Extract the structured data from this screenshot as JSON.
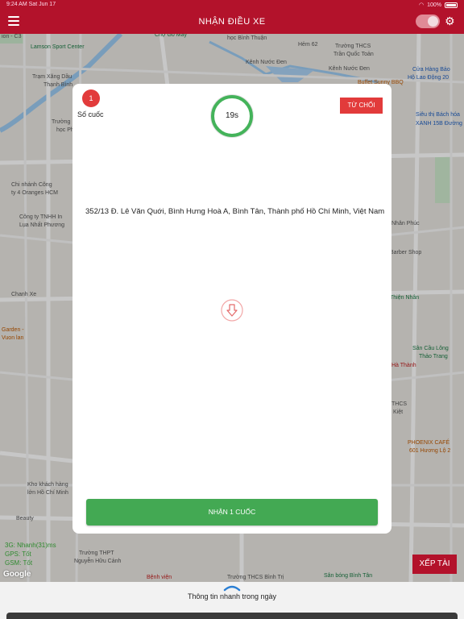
{
  "status_bar": {
    "time_date": "9:24 AM   Sat Jun 17",
    "battery": "100%"
  },
  "header": {
    "title": "NHẬN ĐIỀU XE"
  },
  "map": {
    "labels": [
      {
        "text": "ion - C3",
        "cls": ""
      },
      {
        "text": "Chợ Gò Mây",
        "cls": "green"
      },
      {
        "text": "học Bình Thuận",
        "cls": ""
      },
      {
        "text": "Hẻm 62",
        "cls": ""
      },
      {
        "text": "Trường THCS",
        "cls": ""
      },
      {
        "text": "Trần Quốc Toản",
        "cls": ""
      },
      {
        "text": "Lamson Sport Center",
        "cls": "green"
      },
      {
        "text": "Kênh Nước Đen",
        "cls": ""
      },
      {
        "text": "Kênh Nước Đen",
        "cls": ""
      },
      {
        "text": "Cửa Hàng Bảo",
        "cls": "blue"
      },
      {
        "text": "Hộ Lao Động 20",
        "cls": "blue"
      },
      {
        "text": "Trạm Xăng Dầu",
        "cls": ""
      },
      {
        "text": "Thạnh Bình",
        "cls": ""
      },
      {
        "text": "Buffet Sunny BBQ",
        "cls": "orange"
      },
      {
        "text": "Siêu thị Bách hóa",
        "cls": "blue"
      },
      {
        "text": "XANH 15B Đường 5C",
        "cls": "blue"
      },
      {
        "text": "Trường",
        "cls": ""
      },
      {
        "text": "học Phú Đ",
        "cls": ""
      },
      {
        "text": "Chi nhánh Công",
        "cls": ""
      },
      {
        "text": "ty 4 Oranges HCM",
        "cls": ""
      },
      {
        "text": "Công ty TNHH In",
        "cls": ""
      },
      {
        "text": "Lụa Nhất Phương",
        "cls": ""
      },
      {
        "text": "Nhân Phúc",
        "cls": ""
      },
      {
        "text": "Barber Shop",
        "cls": ""
      },
      {
        "text": "Chanh Xe",
        "cls": ""
      },
      {
        "text": "Thiện Nhân",
        "cls": "green"
      },
      {
        "text": "Garden -",
        "cls": "orange"
      },
      {
        "text": "Vuon lan",
        "cls": "orange"
      },
      {
        "text": "Sân Cầu Lông",
        "cls": "green"
      },
      {
        "text": "Thảo Trang",
        "cls": "green"
      },
      {
        "text": "Hà Thành",
        "cls": "red"
      },
      {
        "text": "THCS",
        "cls": ""
      },
      {
        "text": "Kiệt",
        "cls": ""
      },
      {
        "text": "PHOENIX CAFÉ",
        "cls": "orange"
      },
      {
        "text": "601 Hương Lộ 2",
        "cls": "orange"
      },
      {
        "text": "Kho khách hàng",
        "cls": ""
      },
      {
        "text": "lớn Hồ Chí Minh",
        "cls": ""
      },
      {
        "text": "Beauty",
        "cls": ""
      },
      {
        "text": "Trường THPT",
        "cls": ""
      },
      {
        "text": "Nguyễn Hữu Cảnh",
        "cls": ""
      },
      {
        "text": "Bệnh viện",
        "cls": "red"
      },
      {
        "text": "Trường THCS Bình Trị",
        "cls": ""
      },
      {
        "text": "Sân bóng Bình Tân",
        "cls": "green"
      }
    ]
  },
  "network": {
    "line1": "3G: Nhanh(31)ms",
    "line2": "GPS: Tốt",
    "line3": "GSM: Tốt"
  },
  "google": "Google",
  "xep_tai": "XẾP TÀI",
  "bottom": {
    "label": "Thông tin nhanh trong ngày"
  },
  "dialog": {
    "count": "1",
    "count_label": "Số cuốc",
    "timer": "19s",
    "reject_label": "TỪ CHỐI",
    "address": "352/13 Đ. Lê Văn Quới, Bình Hưng Hoà A, Bình Tân, Thành phố Hồ Chí Minh, Việt Nam",
    "accept_label": "NHẬN 1 CUỐC"
  },
  "colors": {
    "brand": "#b3122b",
    "accept": "#43a953",
    "reject": "#e23b3b",
    "timer_ring": "#44b35a"
  }
}
